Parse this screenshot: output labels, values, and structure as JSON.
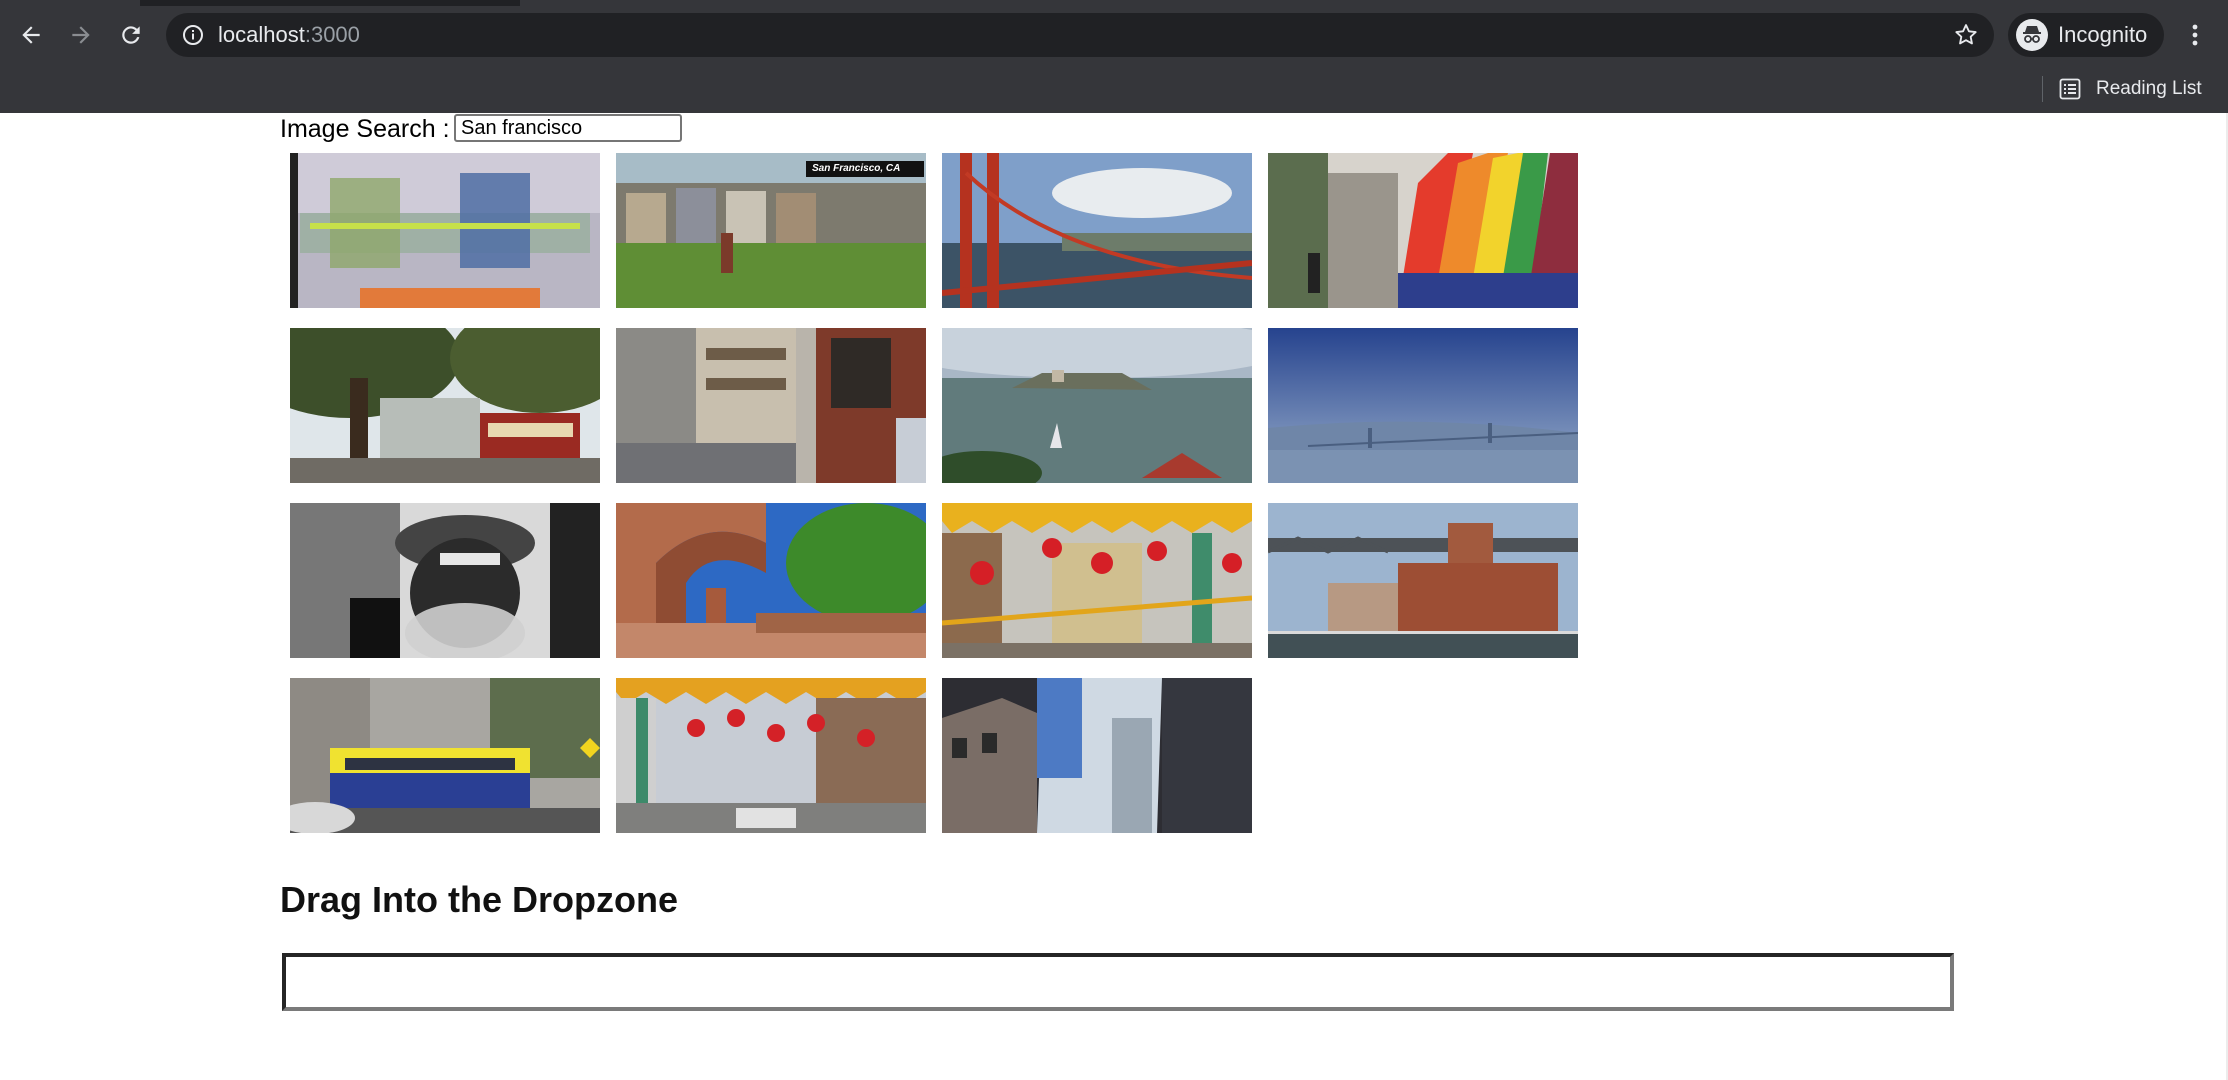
{
  "browser": {
    "url_host": "localhost",
    "url_port": ":3000",
    "profile_label": "Incognito",
    "reading_list_label": "Reading List",
    "icons": {
      "back": "back-arrow-icon",
      "forward": "forward-arrow-icon",
      "reload": "reload-icon",
      "site_info": "info-icon",
      "bookmark": "star-icon",
      "profile": "incognito-icon",
      "menu": "kebab-menu-icon",
      "reading_list": "reading-list-icon"
    },
    "colors": {
      "toolbar": "#35363a",
      "omnibox": "#202124",
      "text": "#e8eaed"
    }
  },
  "search": {
    "label": "Image Search :",
    "value": "San francisco"
  },
  "results": [
    {
      "row": 0,
      "col": 0,
      "caption": ""
    },
    {
      "row": 0,
      "col": 1,
      "caption": "San Francisco, CA"
    },
    {
      "row": 0,
      "col": 2,
      "caption": ""
    },
    {
      "row": 0,
      "col": 3,
      "caption": ""
    },
    {
      "row": 1,
      "col": 0,
      "caption": ""
    },
    {
      "row": 1,
      "col": 1,
      "caption": ""
    },
    {
      "row": 1,
      "col": 2,
      "caption": ""
    },
    {
      "row": 1,
      "col": 3,
      "caption": ""
    },
    {
      "row": 2,
      "col": 0,
      "caption": ""
    },
    {
      "row": 2,
      "col": 1,
      "caption": ""
    },
    {
      "row": 2,
      "col": 2,
      "caption": ""
    },
    {
      "row": 2,
      "col": 3,
      "caption": ""
    },
    {
      "row": 3,
      "col": 0,
      "caption": ""
    },
    {
      "row": 3,
      "col": 1,
      "caption": ""
    },
    {
      "row": 3,
      "col": 2,
      "caption": ""
    }
  ],
  "dropzone": {
    "heading": "Drag Into the Dropzone"
  }
}
